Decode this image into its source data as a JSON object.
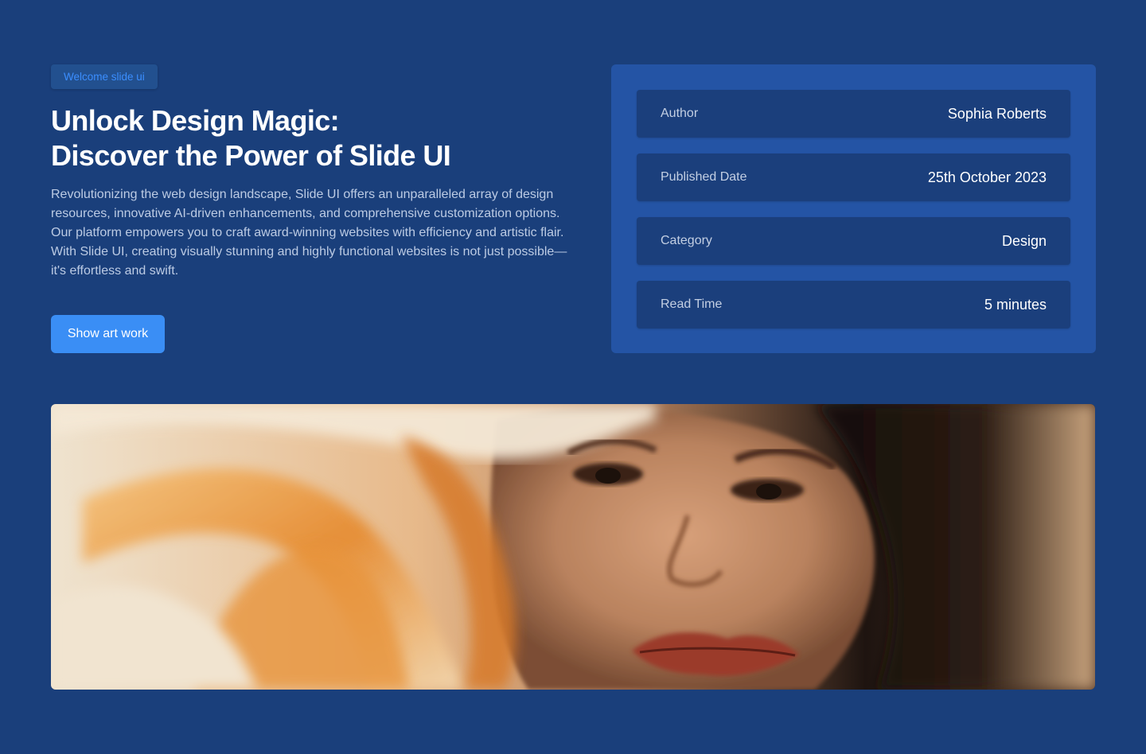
{
  "hero_section": {
    "badge": "Welcome slide ui",
    "title_line1": "Unlock Design Magic:",
    "title_line2": "Discover the Power of Slide UI",
    "description": "Revolutionizing the web design landscape, Slide UI offers an unparalleled array of design resources, innovative AI-driven enhancements, and comprehensive customization options. Our platform empowers you to craft award-winning websites with efficiency and artistic flair. With Slide UI, creating visually stunning and highly functional websites is not just possible—it's effortless and swift.",
    "cta_label": "Show art work"
  },
  "details": [
    {
      "label": "Author",
      "value": "Sophia Roberts"
    },
    {
      "label": "Published Date",
      "value": "25th October 2023"
    },
    {
      "label": "Category",
      "value": "Design"
    },
    {
      "label": "Read Time",
      "value": "5 minutes"
    }
  ],
  "colors": {
    "background": "#1a3f7b",
    "panel": "#2454a5",
    "row": "#1b3f7c",
    "accent": "#3a8ef5",
    "badge_text": "#3b8eff"
  }
}
